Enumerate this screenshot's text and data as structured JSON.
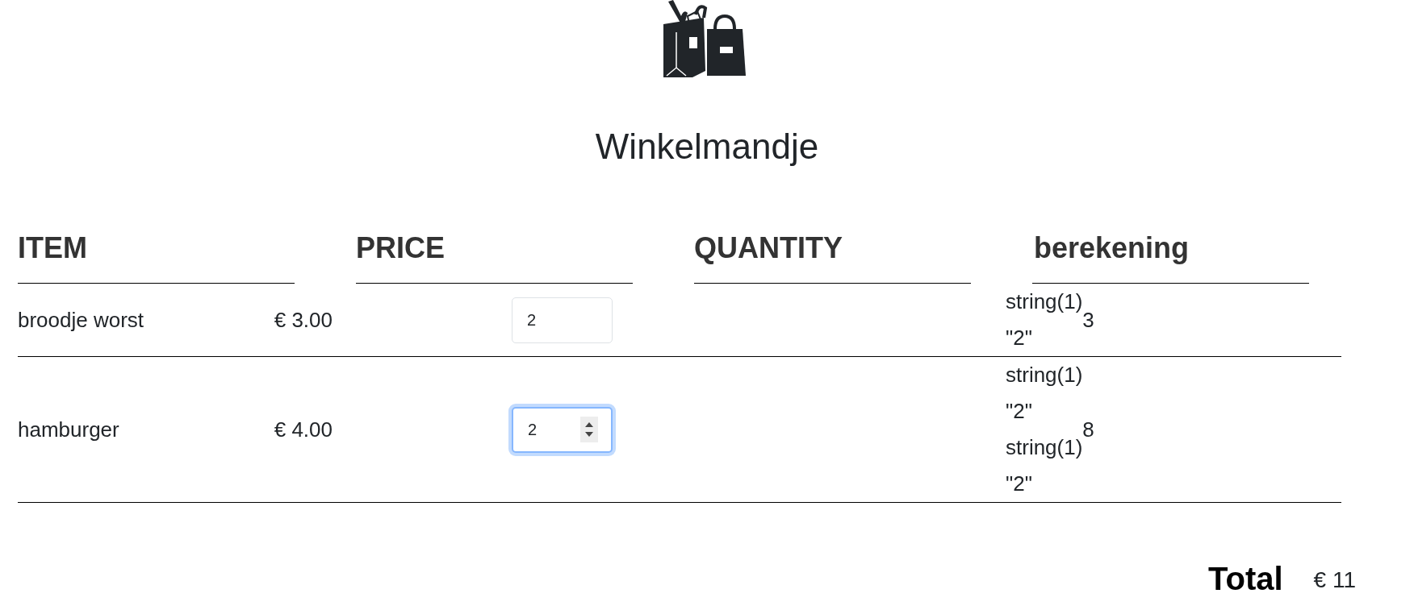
{
  "title": "Winkelmandje",
  "columns": [
    "ITEM",
    "PRICE",
    "QUANTITY",
    "berekening"
  ],
  "rows": [
    {
      "item": "broodje worst",
      "price": "€ 3.00",
      "quantity": "2",
      "focused": false,
      "calc_lines": [
        "string(1)",
        "\"2\""
      ],
      "result": "3"
    },
    {
      "item": "hamburger",
      "price": "€ 4.00",
      "quantity": "2",
      "focused": true,
      "calc_lines": [
        "string(1)",
        "\"2\"",
        "string(1)",
        "\"2\""
      ],
      "result": "8"
    }
  ],
  "total": {
    "label": "Total",
    "value": "€ 11"
  }
}
